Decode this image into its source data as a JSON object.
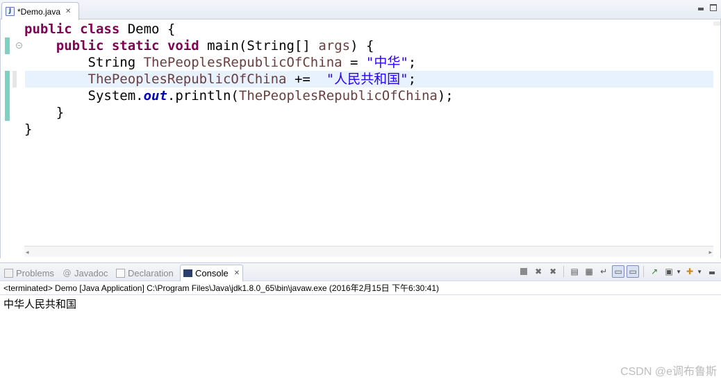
{
  "editor": {
    "tab_label": "*Demo.java",
    "tab_close": "✕",
    "file_icon_letter": "J",
    "code_lines": [
      {
        "parts": [
          {
            "t": "public",
            "c": "kw"
          },
          {
            "t": " "
          },
          {
            "t": "class",
            "c": "kw"
          },
          {
            "t": " Demo {"
          }
        ]
      },
      {
        "parts": [
          {
            "t": "    "
          },
          {
            "t": "public",
            "c": "kw"
          },
          {
            "t": " "
          },
          {
            "t": "static",
            "c": "kw"
          },
          {
            "t": " "
          },
          {
            "t": "void",
            "c": "kw"
          },
          {
            "t": " main(String[] "
          },
          {
            "t": "args",
            "c": "var"
          },
          {
            "t": ") {"
          }
        ]
      },
      {
        "parts": [
          {
            "t": "        String "
          },
          {
            "t": "ThePeoplesRepublicOfChina",
            "c": "var"
          },
          {
            "t": " = "
          },
          {
            "t": "\"中华\"",
            "c": "str"
          },
          {
            "t": ";"
          }
        ]
      },
      {
        "parts": [
          {
            "t": "        "
          },
          {
            "t": "ThePeoplesRepublicOfChina",
            "c": "var"
          },
          {
            "t": " +=  "
          },
          {
            "t": "\"人民共和国\"",
            "c": "str"
          },
          {
            "t": ";"
          }
        ]
      },
      {
        "parts": [
          {
            "t": "        System."
          },
          {
            "t": "out",
            "c": "fld"
          },
          {
            "t": ".println("
          },
          {
            "t": "ThePeoplesRepublicOfChina",
            "c": "var"
          },
          {
            "t": ");"
          }
        ]
      },
      {
        "parts": [
          {
            "t": "    }"
          }
        ]
      },
      {
        "parts": [
          {
            "t": "}"
          }
        ]
      }
    ]
  },
  "views": {
    "tabs": [
      {
        "label": "Problems",
        "icon": "problems-icon",
        "active": false
      },
      {
        "label": "Javadoc",
        "icon": "javadoc-icon",
        "active": false
      },
      {
        "label": "Declaration",
        "icon": "declaration-icon",
        "active": false
      },
      {
        "label": "Console",
        "icon": "console-icon",
        "active": true
      }
    ],
    "console_close": "✕",
    "javadoc_glyph": "@"
  },
  "console": {
    "status": "<terminated> Demo [Java Application] C:\\Program Files\\Java\\jdk1.8.0_65\\bin\\javaw.exe (2016年2月15日 下午6:30:41)",
    "output": "中华人民共和国"
  },
  "watermark": "CSDN @e调布鲁斯",
  "colors": {
    "keyword": "#7f0055",
    "variable": "#6a3e3e",
    "string": "#2a00ff",
    "static_field": "#0000c0",
    "current_line": "#e8f2fe",
    "change_marker": "#82cec0"
  }
}
